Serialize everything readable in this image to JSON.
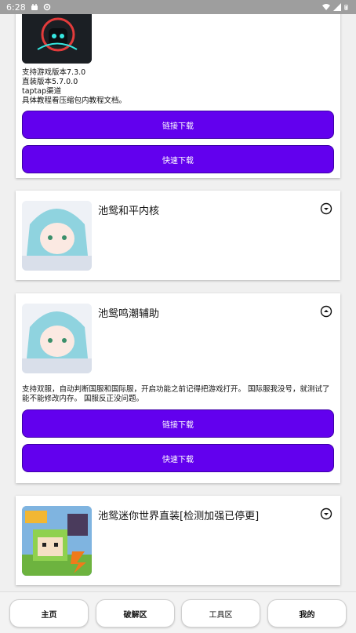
{
  "status_bar": {
    "time": "6:28",
    "icons": [
      "android-icon",
      "settings-icon",
      "wifi-icon",
      "signal-icon",
      "battery-icon"
    ]
  },
  "cards": [
    {
      "id": "card-top",
      "description_lines": [
        "支持游戏版本7.3.0",
        "直装版本5.7.0.0",
        "taptap渠道",
        "具体教程看压缩包内教程文档。"
      ],
      "buttons": [
        "链接下载",
        "快速下载"
      ]
    },
    {
      "id": "card-heping",
      "title": "池鸳和平内核",
      "expanded": false
    },
    {
      "id": "card-mingchao",
      "title": "池鸳鸣潮辅助",
      "expanded": true,
      "description": "支持双服，自动判断国服和国际服，开启功能之前记得把游戏打开。 国际服我没号，就测试了能不能修改内存。 国服反正没问题。",
      "buttons": [
        "链接下载",
        "快速下载"
      ]
    },
    {
      "id": "card-minishijie",
      "title": "池鸳迷你世界直装[检测加强已停更]",
      "expanded": false
    }
  ],
  "bottom_nav": [
    "主页",
    "破解区",
    "工具区",
    "我的"
  ],
  "colors": {
    "primary_button": "#6200ee",
    "status_bar": "#9e9e9e",
    "card_bg": "#ffffff",
    "page_bg": "#f0f0f0"
  }
}
